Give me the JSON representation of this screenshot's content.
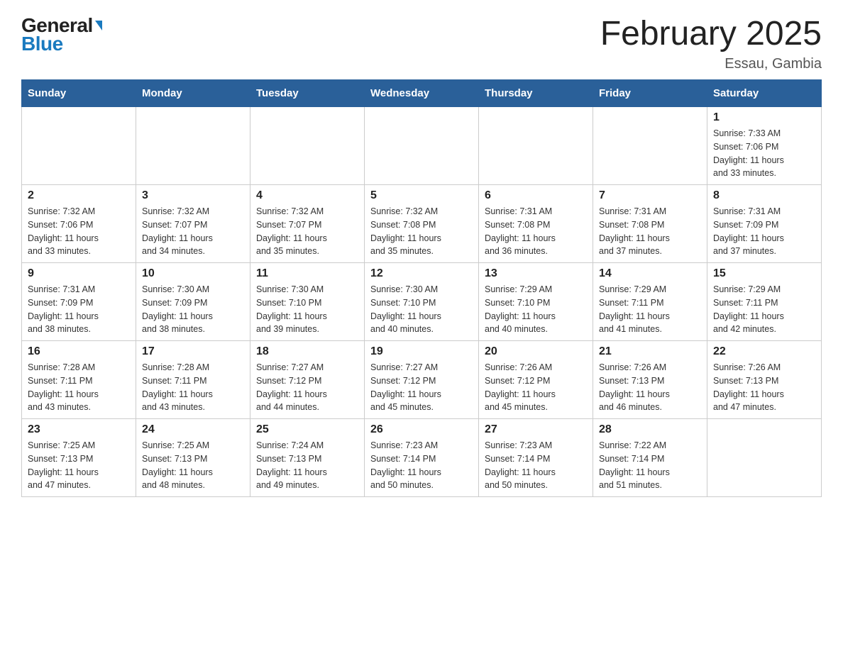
{
  "logo": {
    "general": "General",
    "blue": "Blue"
  },
  "title": "February 2025",
  "location": "Essau, Gambia",
  "days_of_week": [
    "Sunday",
    "Monday",
    "Tuesday",
    "Wednesday",
    "Thursday",
    "Friday",
    "Saturday"
  ],
  "weeks": [
    [
      {
        "day": "",
        "info": ""
      },
      {
        "day": "",
        "info": ""
      },
      {
        "day": "",
        "info": ""
      },
      {
        "day": "",
        "info": ""
      },
      {
        "day": "",
        "info": ""
      },
      {
        "day": "",
        "info": ""
      },
      {
        "day": "1",
        "info": "Sunrise: 7:33 AM\nSunset: 7:06 PM\nDaylight: 11 hours\nand 33 minutes."
      }
    ],
    [
      {
        "day": "2",
        "info": "Sunrise: 7:32 AM\nSunset: 7:06 PM\nDaylight: 11 hours\nand 33 minutes."
      },
      {
        "day": "3",
        "info": "Sunrise: 7:32 AM\nSunset: 7:07 PM\nDaylight: 11 hours\nand 34 minutes."
      },
      {
        "day": "4",
        "info": "Sunrise: 7:32 AM\nSunset: 7:07 PM\nDaylight: 11 hours\nand 35 minutes."
      },
      {
        "day": "5",
        "info": "Sunrise: 7:32 AM\nSunset: 7:08 PM\nDaylight: 11 hours\nand 35 minutes."
      },
      {
        "day": "6",
        "info": "Sunrise: 7:31 AM\nSunset: 7:08 PM\nDaylight: 11 hours\nand 36 minutes."
      },
      {
        "day": "7",
        "info": "Sunrise: 7:31 AM\nSunset: 7:08 PM\nDaylight: 11 hours\nand 37 minutes."
      },
      {
        "day": "8",
        "info": "Sunrise: 7:31 AM\nSunset: 7:09 PM\nDaylight: 11 hours\nand 37 minutes."
      }
    ],
    [
      {
        "day": "9",
        "info": "Sunrise: 7:31 AM\nSunset: 7:09 PM\nDaylight: 11 hours\nand 38 minutes."
      },
      {
        "day": "10",
        "info": "Sunrise: 7:30 AM\nSunset: 7:09 PM\nDaylight: 11 hours\nand 38 minutes."
      },
      {
        "day": "11",
        "info": "Sunrise: 7:30 AM\nSunset: 7:10 PM\nDaylight: 11 hours\nand 39 minutes."
      },
      {
        "day": "12",
        "info": "Sunrise: 7:30 AM\nSunset: 7:10 PM\nDaylight: 11 hours\nand 40 minutes."
      },
      {
        "day": "13",
        "info": "Sunrise: 7:29 AM\nSunset: 7:10 PM\nDaylight: 11 hours\nand 40 minutes."
      },
      {
        "day": "14",
        "info": "Sunrise: 7:29 AM\nSunset: 7:11 PM\nDaylight: 11 hours\nand 41 minutes."
      },
      {
        "day": "15",
        "info": "Sunrise: 7:29 AM\nSunset: 7:11 PM\nDaylight: 11 hours\nand 42 minutes."
      }
    ],
    [
      {
        "day": "16",
        "info": "Sunrise: 7:28 AM\nSunset: 7:11 PM\nDaylight: 11 hours\nand 43 minutes."
      },
      {
        "day": "17",
        "info": "Sunrise: 7:28 AM\nSunset: 7:11 PM\nDaylight: 11 hours\nand 43 minutes."
      },
      {
        "day": "18",
        "info": "Sunrise: 7:27 AM\nSunset: 7:12 PM\nDaylight: 11 hours\nand 44 minutes."
      },
      {
        "day": "19",
        "info": "Sunrise: 7:27 AM\nSunset: 7:12 PM\nDaylight: 11 hours\nand 45 minutes."
      },
      {
        "day": "20",
        "info": "Sunrise: 7:26 AM\nSunset: 7:12 PM\nDaylight: 11 hours\nand 45 minutes."
      },
      {
        "day": "21",
        "info": "Sunrise: 7:26 AM\nSunset: 7:13 PM\nDaylight: 11 hours\nand 46 minutes."
      },
      {
        "day": "22",
        "info": "Sunrise: 7:26 AM\nSunset: 7:13 PM\nDaylight: 11 hours\nand 47 minutes."
      }
    ],
    [
      {
        "day": "23",
        "info": "Sunrise: 7:25 AM\nSunset: 7:13 PM\nDaylight: 11 hours\nand 47 minutes."
      },
      {
        "day": "24",
        "info": "Sunrise: 7:25 AM\nSunset: 7:13 PM\nDaylight: 11 hours\nand 48 minutes."
      },
      {
        "day": "25",
        "info": "Sunrise: 7:24 AM\nSunset: 7:13 PM\nDaylight: 11 hours\nand 49 minutes."
      },
      {
        "day": "26",
        "info": "Sunrise: 7:23 AM\nSunset: 7:14 PM\nDaylight: 11 hours\nand 50 minutes."
      },
      {
        "day": "27",
        "info": "Sunrise: 7:23 AM\nSunset: 7:14 PM\nDaylight: 11 hours\nand 50 minutes."
      },
      {
        "day": "28",
        "info": "Sunrise: 7:22 AM\nSunset: 7:14 PM\nDaylight: 11 hours\nand 51 minutes."
      },
      {
        "day": "",
        "info": ""
      }
    ]
  ]
}
